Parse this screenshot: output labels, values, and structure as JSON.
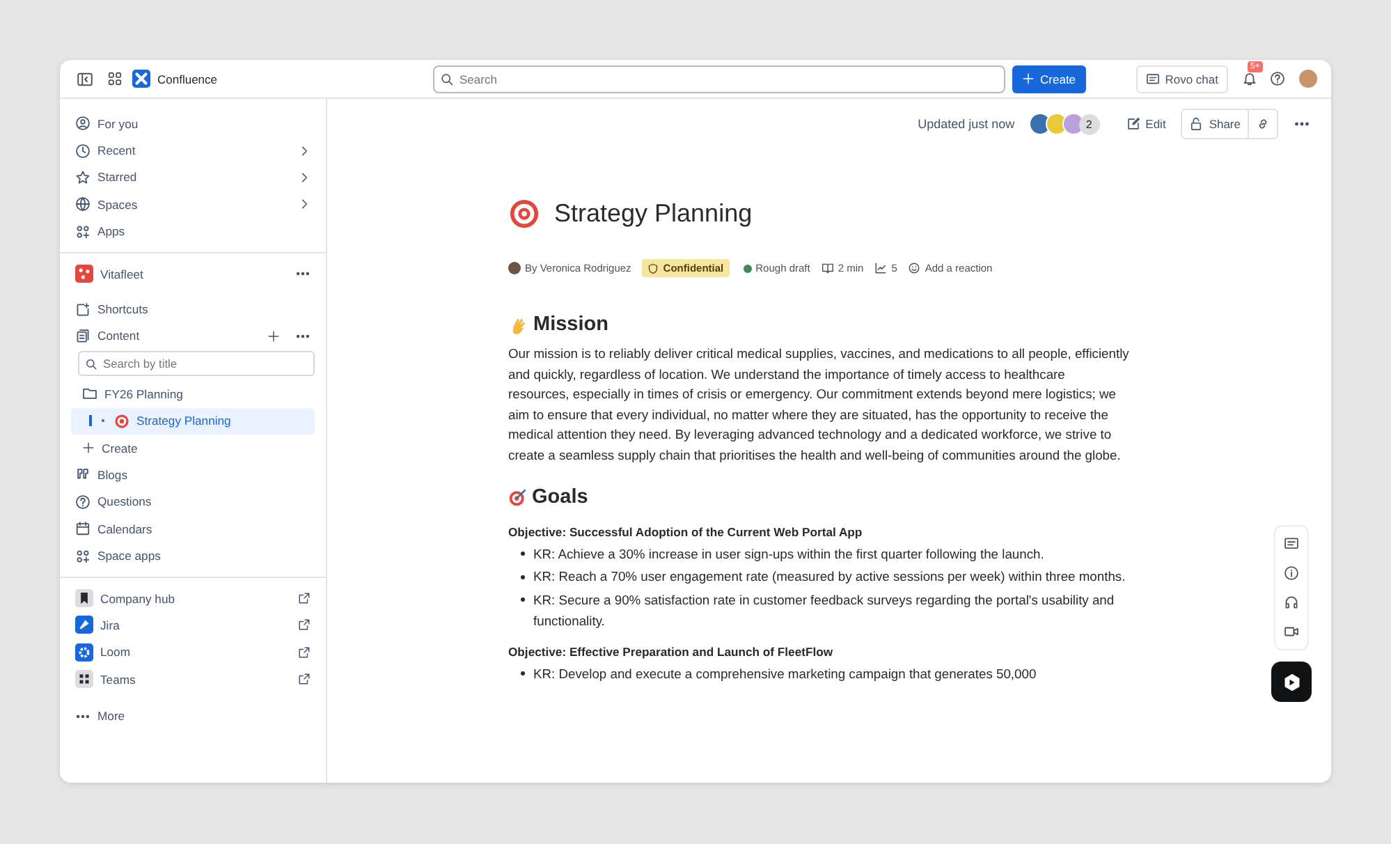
{
  "topbar": {
    "product": "Confluence",
    "search": {
      "placeholder": "Search"
    },
    "create_button": "Create",
    "rovo_button": "Rovo chat",
    "notification_badge": "5+"
  },
  "sidebar": {
    "nav": [
      {
        "label": "For you",
        "chevron": false
      },
      {
        "label": "Recent",
        "chevron": true
      },
      {
        "label": "Starred",
        "chevron": true
      },
      {
        "label": "Spaces",
        "chevron": true
      },
      {
        "label": "Apps",
        "chevron": false
      }
    ],
    "space": {
      "name": "Vitafleet",
      "items": [
        {
          "label": "Shortcuts",
          "kind": "plain"
        },
        {
          "label": "Content",
          "kind": "content"
        }
      ],
      "search": {
        "placeholder": "Search by title"
      },
      "tree": [
        {
          "label": "FY26 Planning",
          "selected": false,
          "children": [
            {
              "label": "Strategy Planning",
              "selected": true
            }
          ]
        }
      ],
      "create": "Create",
      "more_items": [
        "Blogs",
        "Questions",
        "Calendars",
        "Space apps"
      ]
    },
    "apps": [
      "Company hub",
      "Jira",
      "Loom",
      "Teams"
    ],
    "more": "More"
  },
  "page_header": {
    "updated": "Updated just now",
    "viewer_count": "2",
    "edit_button": "Edit",
    "share_button": "Share"
  },
  "page": {
    "title": "Strategy Planning",
    "byline": "By Veronica Rodriguez",
    "classification": "Confidential",
    "status": {
      "label": "Rough draft",
      "color": "#3c8a5c"
    },
    "read_time": "2 min",
    "views": "5",
    "reaction": "Add a reaction",
    "mission": {
      "heading": "Mission",
      "text": "Our mission is to reliably deliver critical medical supplies, vaccines, and medications to all people, efficiently and quickly, regardless of location. We understand the importance of timely access to healthcare resources, especially in times of crisis or emergency. Our commitment extends beyond mere logistics; we aim to ensure that every individual, no matter where they are situated, has the opportunity to receive the medical attention they need. By leveraging advanced technology and a dedicated workforce, we strive to create a seamless supply chain that prioritises the health and well-being of communities around the globe."
    },
    "goals": {
      "heading": "Goals",
      "objectives": [
        {
          "title": "Objective: Successful Adoption of the Current Web Portal App",
          "krs": [
            "KR: Achieve a 30% increase in user sign-ups within the first quarter following the launch.",
            "KR: Reach a 70% user engagement rate (measured by active sessions per week) within three months.",
            "KR: Secure a 90% satisfaction rate in customer feedback surveys regarding the portal's usability and functionality."
          ]
        },
        {
          "title": "Objective: Effective Preparation and Launch of FleetFlow",
          "krs": [
            "KR: Develop and execute a comprehensive marketing campaign that generates 50,000"
          ]
        }
      ]
    }
  }
}
